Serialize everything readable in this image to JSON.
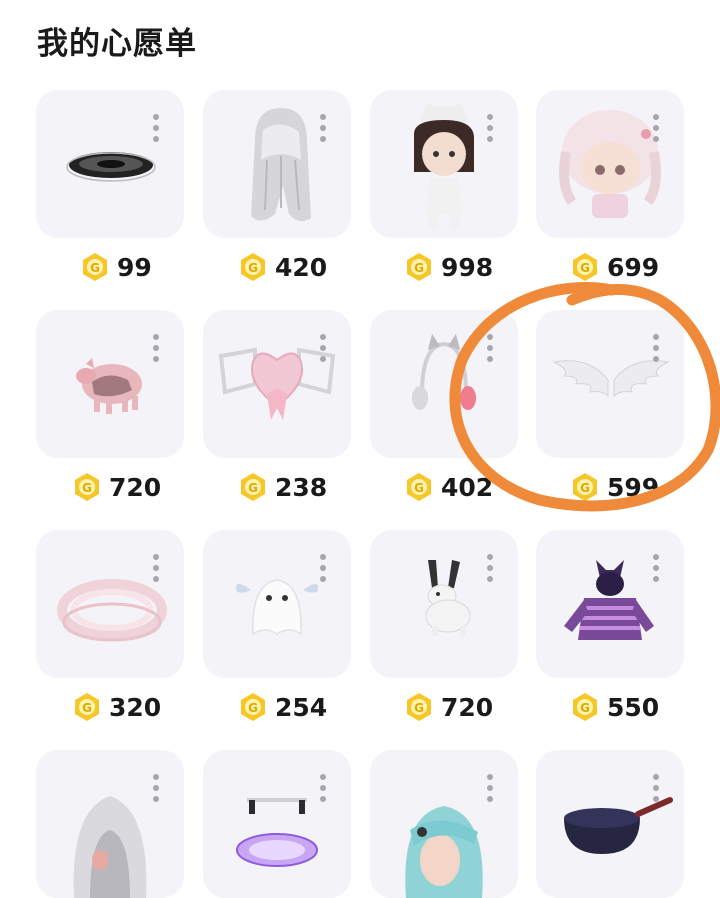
{
  "page": {
    "title": "我的心愿单"
  },
  "items": [
    {
      "name": "black-halo-disc",
      "price": "99"
    },
    {
      "name": "white-long-hair",
      "price": "420"
    },
    {
      "name": "doll-with-bear-hat",
      "price": "998"
    },
    {
      "name": "pink-haired-doll-head",
      "price": "699"
    },
    {
      "name": "pink-pig",
      "price": "720"
    },
    {
      "name": "pink-heart-ribbon-accessory",
      "price": "238"
    },
    {
      "name": "cat-ear-headphones",
      "price": "402"
    },
    {
      "name": "white-angel-wings",
      "price": "599"
    },
    {
      "name": "pink-lace-ring",
      "price": "320"
    },
    {
      "name": "ghost-with-wings",
      "price": "254"
    },
    {
      "name": "white-rabbit",
      "price": "720"
    },
    {
      "name": "purple-striped-cat-hoodie",
      "price": "550"
    },
    {
      "name": "silver-haired-hood",
      "price": ""
    },
    {
      "name": "purple-glowing-platform",
      "price": ""
    },
    {
      "name": "teal-haired-head",
      "price": ""
    },
    {
      "name": "frying-pan",
      "price": ""
    }
  ],
  "colors": {
    "accent_circle": "#ef8a3a",
    "coin": "#f7c629",
    "card_bg": "#f4f3f7"
  }
}
